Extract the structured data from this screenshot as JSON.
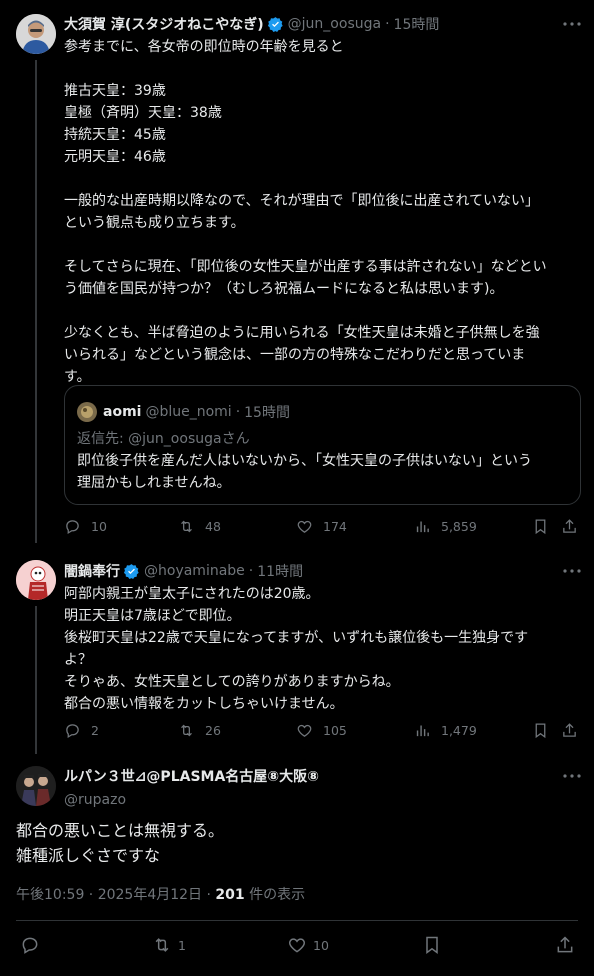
{
  "tweet1": {
    "name": "大須賀 淳(スタジオねこやなぎ)",
    "handle": "@jun_oosuga",
    "dot": "·",
    "time": "15時間",
    "lines": [
      "参考までに、各女帝の即位時の年齢を見ると",
      "",
      "推古天皇：39歳",
      "皇極（斉明）天皇：38歳",
      "持統天皇：45歳",
      "元明天皇：46歳",
      "",
      "一般的な出産時期以降なので、それが理由で「即位後に出産されていない」",
      "という観点も成り立ちます。",
      "",
      "そしてさらに現在、「即位後の女性天皇が出産する事は許されない」などとい",
      "う価値を国民が持つか？（むしろ祝福ムードになると私は思います)。",
      "",
      "少なくとも、半ば脅迫のように用いられる「女性天皇は未婚と子供無しを強",
      "いられる」などという観念は、一部の方の特殊なこだわりだと思っていま",
      "す。"
    ],
    "quote": {
      "name": "aomi",
      "handle": "@blue_nomi",
      "dot": "·",
      "time": "15時間",
      "reply_prefix": "返信先: ",
      "reply_handle": "@jun_oosuga",
      "reply_suffix": "さん",
      "lines": [
        "即位後子供を産んだ人はいないから、「女性天皇の子供はいない」という",
        "理屈かもしれませんね。"
      ]
    },
    "actions": {
      "replies": "10",
      "reposts": "48",
      "likes": "174",
      "views": "5,859"
    }
  },
  "tweet2": {
    "name": "闇鍋奉行",
    "handle": "@hoyaminabe",
    "dot": "·",
    "time": "11時間",
    "lines": [
      "阿部内親王が皇太子にされたのは20歳。",
      "明正天皇は7歳ほどで即位。",
      "後桜町天皇は22歳で天皇になってますが、いずれも譲位後も一生独身です",
      "よ？",
      "そりゃあ、女性天皇としての誇りがありますからね。",
      "都合の悪い情報をカットしちゃいけません。"
    ],
    "actions": {
      "replies": "2",
      "reposts": "26",
      "likes": "105",
      "views": "1,479"
    }
  },
  "main": {
    "name": "ルパン３世⊿@PLASMA名古屋⑧大阪⑧",
    "handle": "@rupazo",
    "lines": [
      "都合の悪いことは無視する。",
      "雑種派しぐさですな"
    ],
    "timestamp": "午後10:59 · 2025年4月12日 · ",
    "views_count": "201",
    "views_label": " 件の表示",
    "actions": {
      "replies": "",
      "reposts": "1",
      "likes": "10"
    }
  },
  "colors": {
    "background": "#000000",
    "text": "#e7e9ea",
    "muted": "#71767b",
    "border": "#2f3336",
    "verified": "#1d9bf0"
  },
  "icons": [
    "more-icon",
    "verified-badge-icon",
    "reply-icon",
    "repost-icon",
    "like-icon",
    "views-icon",
    "bookmark-icon",
    "share-icon"
  ]
}
